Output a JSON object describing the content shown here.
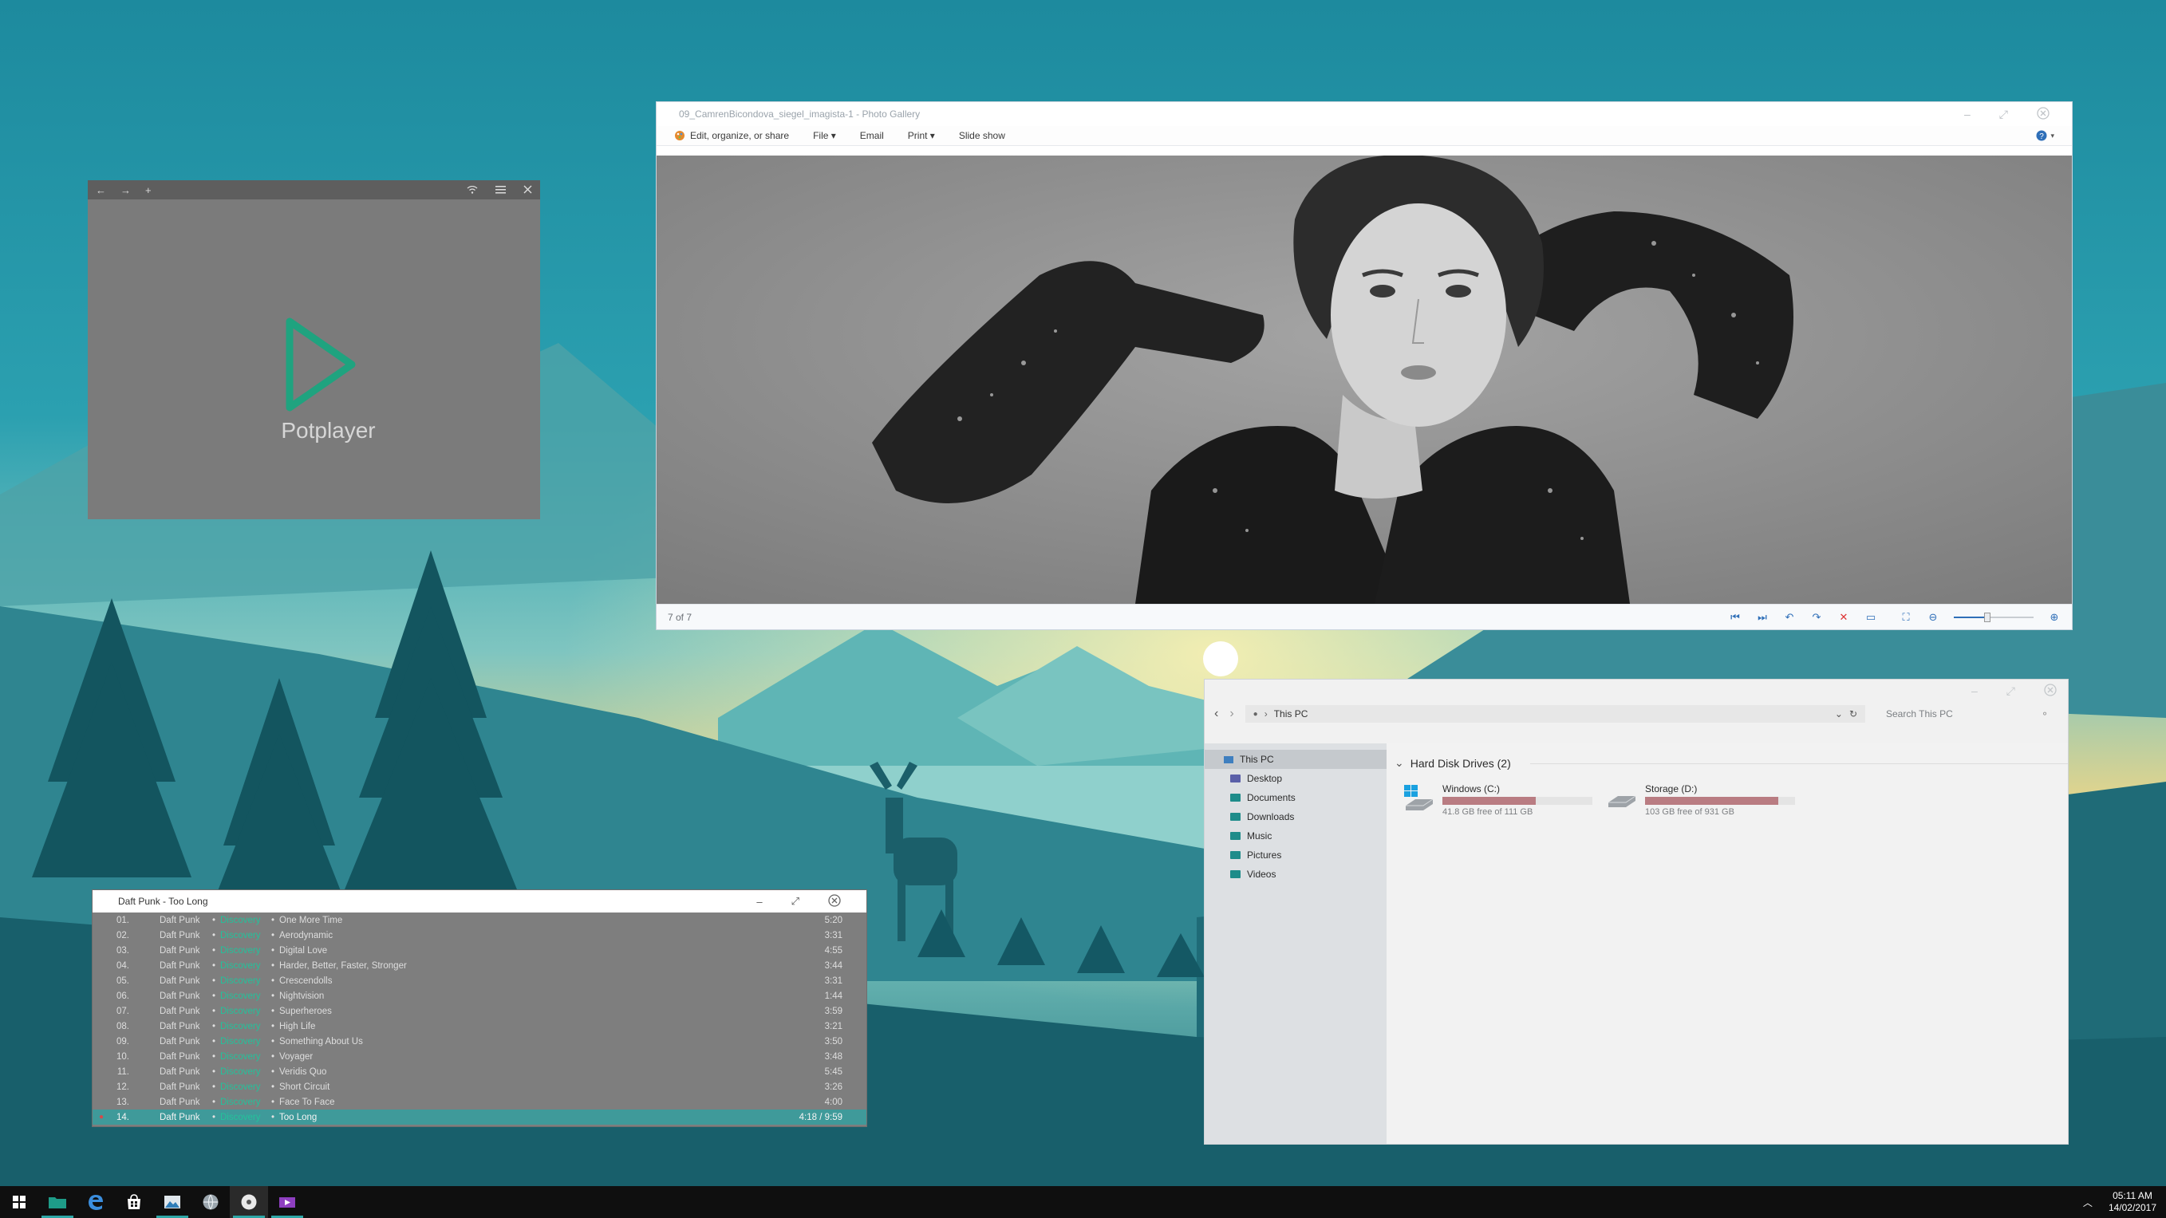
{
  "potplayer": {
    "app_name": "Potplayer",
    "nav": [
      "←",
      "→",
      "+"
    ],
    "accent": "#1fa37f"
  },
  "gallery": {
    "title": "09_CamrenBicondova_siegel_imagista-1 - Photo Gallery",
    "menu": {
      "edit": "Edit, organize, or share",
      "file": "File ▾",
      "email": "Email",
      "print": "Print ▾",
      "slideshow": "Slide show"
    },
    "status": "7 of 7"
  },
  "explorer": {
    "address": "This PC",
    "search_placeholder": "Search This PC",
    "nav": [
      {
        "label": "This PC",
        "selected": true
      },
      {
        "label": "Desktop"
      },
      {
        "label": "Documents"
      },
      {
        "label": "Downloads"
      },
      {
        "label": "Music"
      },
      {
        "label": "Pictures"
      },
      {
        "label": "Videos"
      }
    ],
    "group": "Hard Disk Drives (2)",
    "drives": [
      {
        "name": "Windows (C:)",
        "free": "41.8 GB free of 111 GB",
        "used_fraction": 0.62
      },
      {
        "name": "Storage (D:)",
        "free": "103 GB free of 931 GB",
        "used_fraction": 0.89
      }
    ],
    "bar_color": "#b97c82"
  },
  "music": {
    "title": "Daft Punk - Too Long",
    "tracks": [
      {
        "num": "01.",
        "artist": "Daft Punk",
        "album": "Discovery",
        "title": "One More Time",
        "dur": "5:20"
      },
      {
        "num": "02.",
        "artist": "Daft Punk",
        "album": "Discovery",
        "title": "Aerodynamic",
        "dur": "3:31"
      },
      {
        "num": "03.",
        "artist": "Daft Punk",
        "album": "Discovery",
        "title": "Digital Love",
        "dur": "4:55"
      },
      {
        "num": "04.",
        "artist": "Daft Punk",
        "album": "Discovery",
        "title": "Harder, Better, Faster, Stronger",
        "dur": "3:44"
      },
      {
        "num": "05.",
        "artist": "Daft Punk",
        "album": "Discovery",
        "title": "Crescendolls",
        "dur": "3:31"
      },
      {
        "num": "06.",
        "artist": "Daft Punk",
        "album": "Discovery",
        "title": "Nightvision",
        "dur": "1:44"
      },
      {
        "num": "07.",
        "artist": "Daft Punk",
        "album": "Discovery",
        "title": "Superheroes",
        "dur": "3:59"
      },
      {
        "num": "08.",
        "artist": "Daft Punk",
        "album": "Discovery",
        "title": "High Life",
        "dur": "3:21"
      },
      {
        "num": "09.",
        "artist": "Daft Punk",
        "album": "Discovery",
        "title": "Something About Us",
        "dur": "3:50"
      },
      {
        "num": "10.",
        "artist": "Daft Punk",
        "album": "Discovery",
        "title": "Voyager",
        "dur": "3:48"
      },
      {
        "num": "11.",
        "artist": "Daft Punk",
        "album": "Discovery",
        "title": "Veridis Quo",
        "dur": "5:45"
      },
      {
        "num": "12.",
        "artist": "Daft Punk",
        "album": "Discovery",
        "title": "Short Circuit",
        "dur": "3:26"
      },
      {
        "num": "13.",
        "artist": "Daft Punk",
        "album": "Discovery",
        "title": "Face To Face",
        "dur": "4:00"
      },
      {
        "num": "14.",
        "artist": "Daft Punk",
        "album": "Discovery",
        "title": "Too Long",
        "dur": "4:18 / 9:59",
        "current": true
      }
    ],
    "album_color": "#23c29b",
    "current_color": "#3f9a9a"
  },
  "taskbar": {
    "time": "05:11 AM",
    "date": "14/02/2017"
  }
}
